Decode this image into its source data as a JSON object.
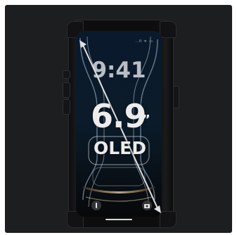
{
  "image": {
    "background_color": "#1d1e20",
    "accent_color": "#ececec"
  },
  "phone": {
    "status_bar": "..ll ᯤ ▭",
    "lock_time": "9:41",
    "screen_size": "6.9",
    "inch_mark": "”",
    "display_type": "OLED",
    "flashlight_icon": "flashlight-icon",
    "camera_icon": "camera-icon"
  }
}
